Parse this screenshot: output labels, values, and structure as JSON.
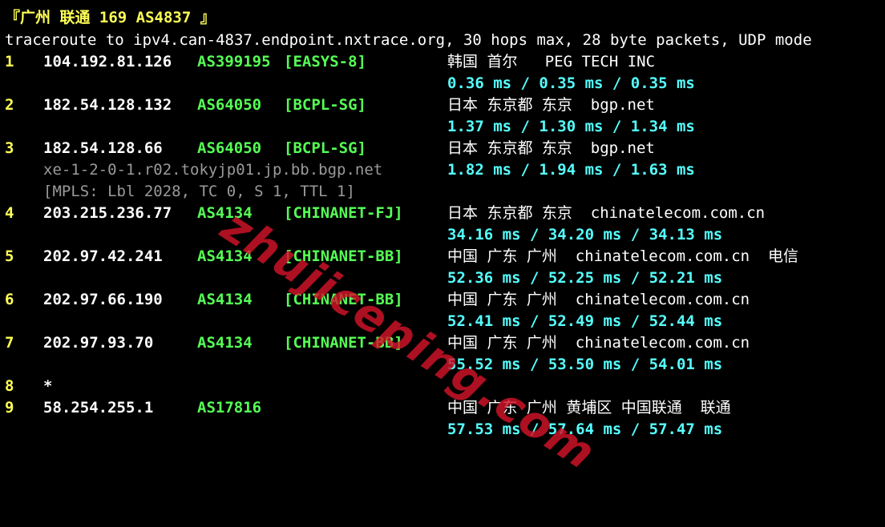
{
  "title": "『广州 联通 169 AS4837 』",
  "header": "traceroute to ipv4.can-4837.endpoint.nxtrace.org, 30 hops max, 28 byte packets, UDP mode",
  "watermark": "zhujiceping.com",
  "colors": {
    "background": "#000000",
    "title": "#ffff55",
    "hop_number": "#ffff55",
    "ip": "#ffffff",
    "asn": "#55ff55",
    "rtt": "#55ffff",
    "secondary": "#9a9a9a",
    "watermark": "#d21428"
  },
  "hops": [
    {
      "num": "1",
      "ip": "104.192.81.126",
      "asn": "AS399195",
      "tag": "[EASYS-8]",
      "geo": "韩国 首尔   PEG TECH INC",
      "rtt": "0.36 ms / 0.35 ms / 0.35 ms"
    },
    {
      "num": "2",
      "ip": "182.54.128.132",
      "asn": "AS64050",
      "tag": "[BCPL-SG]",
      "geo": "日本 东京都 东京  bgp.net",
      "rtt": "1.37 ms / 1.30 ms / 1.34 ms"
    },
    {
      "num": "3",
      "ip": "182.54.128.66",
      "asn": "AS64050",
      "tag": "[BCPL-SG]",
      "geo": "日本 东京都 东京  bgp.net",
      "rdns": "xe-1-2-0-1.r02.tokyjp01.jp.bb.bgp.net",
      "rtt": "1.82 ms / 1.94 ms / 1.63 ms",
      "mpls": "[MPLS: Lbl 2028, TC 0, S 1, TTL 1]"
    },
    {
      "num": "4",
      "ip": "203.215.236.77",
      "asn": "AS4134",
      "tag": "[CHINANET-FJ]",
      "geo": "日本 东京都 东京  chinatelecom.com.cn",
      "rtt": "34.16 ms / 34.20 ms / 34.13 ms"
    },
    {
      "num": "5",
      "ip": "202.97.42.241",
      "asn": "AS4134",
      "tag": "[CHINANET-BB]",
      "geo": "中国 广东 广州  chinatelecom.com.cn  电信",
      "rtt": "52.36 ms / 52.25 ms / 52.21 ms"
    },
    {
      "num": "6",
      "ip": "202.97.66.190",
      "asn": "AS4134",
      "tag": "[CHINANET-BB]",
      "geo": "中国 广东 广州  chinatelecom.com.cn",
      "rtt": "52.41 ms / 52.49 ms / 52.44 ms"
    },
    {
      "num": "7",
      "ip": "202.97.93.70",
      "asn": "AS4134",
      "tag": "[CHINANET-BB]",
      "geo": "中国 广东 广州  chinatelecom.com.cn",
      "rtt": "55.52 ms / 53.50 ms / 54.01 ms"
    },
    {
      "num": "8",
      "star": "*"
    },
    {
      "num": "9",
      "ip": "58.254.255.1",
      "asn": "AS17816",
      "geo": "中国 广东 广州 黄埔区 中国联通  联通",
      "rtt": "57.53 ms / 57.64 ms / 57.47 ms"
    }
  ]
}
